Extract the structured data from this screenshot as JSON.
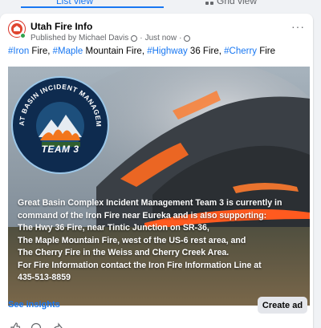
{
  "tabs": {
    "list_label": "List view",
    "grid_label": "Grid view"
  },
  "post": {
    "page_name": "Utah Fire Info",
    "published_by": "Published by Michael Davis",
    "time": "Just now",
    "separator": "·",
    "caption": [
      {
        "text": "#Iron",
        "tag": true
      },
      {
        "text": " Fire, ",
        "tag": false
      },
      {
        "text": "#Maple",
        "tag": true
      },
      {
        "text": " Mountain Fire, ",
        "tag": false
      },
      {
        "text": "#Highway",
        "tag": true
      },
      {
        "text": " 36 Fire, ",
        "tag": false
      },
      {
        "text": "#Cherry",
        "tag": true
      },
      {
        "text": " Fire",
        "tag": false
      }
    ],
    "logo": {
      "ring_text": "GREAT BASIN INCIDENT MANAGEMENT",
      "team": "TEAM 3"
    },
    "image_text": [
      "Great Basin Complex Incident Management Team 3 is currently in",
      "command of the Iron Fire near Eureka and is also supporting:",
      "The Hwy 36 Fire, near Tintic Junction on SR-36,",
      "The Maple Mountain Fire, west of the US-6 rest area, and",
      "The Cherry Fire in the Weiss and Cherry Creek Area.",
      "For Fire Information contact the Iron Fire Information Line at",
      "435-513-8859"
    ],
    "see_insights": "See insights",
    "create_ad": "Create ad"
  },
  "colors": {
    "accent": "#1877f2",
    "muted": "#65676b",
    "fire": "#ff5a1f"
  }
}
